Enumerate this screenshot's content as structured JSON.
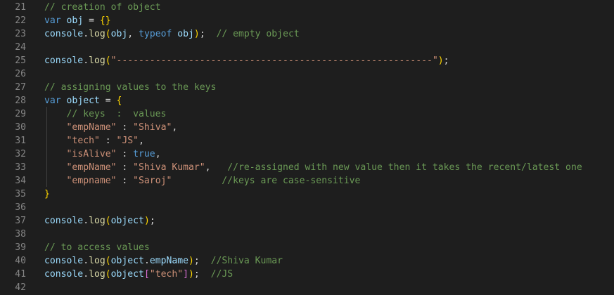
{
  "editor": {
    "theme": {
      "background": "#1e1e1e",
      "line_number": "#858585",
      "comment": "#6a9955",
      "keyword": "#569cd6",
      "variable": "#9cdcfe",
      "function": "#dcdcaa",
      "plain": "#d4d4d4",
      "string": "#ce9178",
      "bracket": "#ffd700",
      "bracket2": "#da70d6"
    },
    "lines": [
      {
        "num": "21",
        "tokens": [
          {
            "t": "// creation of object",
            "c": "comment"
          }
        ]
      },
      {
        "num": "22",
        "tokens": [
          {
            "t": "var",
            "c": "keyword"
          },
          {
            "t": " ",
            "c": "plain"
          },
          {
            "t": "obj",
            "c": "var"
          },
          {
            "t": " = ",
            "c": "plain"
          },
          {
            "t": "{}",
            "c": "bracket"
          }
        ]
      },
      {
        "num": "23",
        "tokens": [
          {
            "t": "console",
            "c": "var"
          },
          {
            "t": ".",
            "c": "plain"
          },
          {
            "t": "log",
            "c": "func"
          },
          {
            "t": "(",
            "c": "bracket"
          },
          {
            "t": "obj",
            "c": "var"
          },
          {
            "t": ", ",
            "c": "plain"
          },
          {
            "t": "typeof",
            "c": "keyword"
          },
          {
            "t": " ",
            "c": "plain"
          },
          {
            "t": "obj",
            "c": "var"
          },
          {
            "t": ")",
            "c": "bracket"
          },
          {
            "t": ";  ",
            "c": "plain"
          },
          {
            "t": "// empty object",
            "c": "comment"
          }
        ]
      },
      {
        "num": "24",
        "tokens": []
      },
      {
        "num": "25",
        "tokens": [
          {
            "t": "console",
            "c": "var"
          },
          {
            "t": ".",
            "c": "plain"
          },
          {
            "t": "log",
            "c": "func"
          },
          {
            "t": "(",
            "c": "bracket"
          },
          {
            "t": "\"---------------------------------------------------------\"",
            "c": "string"
          },
          {
            "t": ")",
            "c": "bracket"
          },
          {
            "t": ";",
            "c": "plain"
          }
        ]
      },
      {
        "num": "26",
        "tokens": []
      },
      {
        "num": "27",
        "tokens": [
          {
            "t": "// assigning values to the keys",
            "c": "comment"
          }
        ]
      },
      {
        "num": "28",
        "tokens": [
          {
            "t": "var",
            "c": "keyword"
          },
          {
            "t": " ",
            "c": "plain"
          },
          {
            "t": "object",
            "c": "var"
          },
          {
            "t": " = ",
            "c": "plain"
          },
          {
            "t": "{",
            "c": "bracket"
          }
        ]
      },
      {
        "num": "29",
        "tokens": [
          {
            "t": "    ",
            "c": "plain"
          },
          {
            "t": "// keys  :  values",
            "c": "comment"
          }
        ]
      },
      {
        "num": "30",
        "tokens": [
          {
            "t": "    ",
            "c": "plain"
          },
          {
            "t": "\"empName\"",
            "c": "string"
          },
          {
            "t": " : ",
            "c": "plain"
          },
          {
            "t": "\"Shiva\"",
            "c": "string"
          },
          {
            "t": ",",
            "c": "plain"
          }
        ]
      },
      {
        "num": "31",
        "tokens": [
          {
            "t": "    ",
            "c": "plain"
          },
          {
            "t": "\"tech\"",
            "c": "string"
          },
          {
            "t": " : ",
            "c": "plain"
          },
          {
            "t": "\"JS\"",
            "c": "string"
          },
          {
            "t": ",",
            "c": "plain"
          }
        ]
      },
      {
        "num": "32",
        "tokens": [
          {
            "t": "    ",
            "c": "plain"
          },
          {
            "t": "\"isAlive\"",
            "c": "string"
          },
          {
            "t": " : ",
            "c": "plain"
          },
          {
            "t": "true",
            "c": "bool"
          },
          {
            "t": ",",
            "c": "plain"
          }
        ]
      },
      {
        "num": "33",
        "tokens": [
          {
            "t": "    ",
            "c": "plain"
          },
          {
            "t": "\"empName\"",
            "c": "string"
          },
          {
            "t": " : ",
            "c": "plain"
          },
          {
            "t": "\"Shiva Kumar\"",
            "c": "string"
          },
          {
            "t": ",   ",
            "c": "plain"
          },
          {
            "t": "//re-assigned with new value then it takes the recent/latest one",
            "c": "comment"
          }
        ]
      },
      {
        "num": "34",
        "tokens": [
          {
            "t": "    ",
            "c": "plain"
          },
          {
            "t": "\"empname\"",
            "c": "string"
          },
          {
            "t": " : ",
            "c": "plain"
          },
          {
            "t": "\"Saroj\"",
            "c": "string"
          },
          {
            "t": "         ",
            "c": "plain"
          },
          {
            "t": "//keys are case-sensitive",
            "c": "comment"
          }
        ]
      },
      {
        "num": "35",
        "tokens": [
          {
            "t": "}",
            "c": "bracket"
          }
        ]
      },
      {
        "num": "36",
        "tokens": []
      },
      {
        "num": "37",
        "tokens": [
          {
            "t": "console",
            "c": "var"
          },
          {
            "t": ".",
            "c": "plain"
          },
          {
            "t": "log",
            "c": "func"
          },
          {
            "t": "(",
            "c": "bracket"
          },
          {
            "t": "object",
            "c": "var"
          },
          {
            "t": ")",
            "c": "bracket"
          },
          {
            "t": ";",
            "c": "plain"
          }
        ]
      },
      {
        "num": "38",
        "tokens": []
      },
      {
        "num": "39",
        "tokens": [
          {
            "t": "// to access values",
            "c": "comment"
          }
        ]
      },
      {
        "num": "40",
        "tokens": [
          {
            "t": "console",
            "c": "var"
          },
          {
            "t": ".",
            "c": "plain"
          },
          {
            "t": "log",
            "c": "func"
          },
          {
            "t": "(",
            "c": "bracket"
          },
          {
            "t": "object",
            "c": "var"
          },
          {
            "t": ".",
            "c": "plain"
          },
          {
            "t": "empName",
            "c": "var"
          },
          {
            "t": ")",
            "c": "bracket"
          },
          {
            "t": ";  ",
            "c": "plain"
          },
          {
            "t": "//Shiva Kumar",
            "c": "comment"
          }
        ]
      },
      {
        "num": "41",
        "tokens": [
          {
            "t": "console",
            "c": "var"
          },
          {
            "t": ".",
            "c": "plain"
          },
          {
            "t": "log",
            "c": "func"
          },
          {
            "t": "(",
            "c": "bracket"
          },
          {
            "t": "object",
            "c": "var"
          },
          {
            "t": "[",
            "c": "bracket2"
          },
          {
            "t": "\"tech\"",
            "c": "string"
          },
          {
            "t": "]",
            "c": "bracket2"
          },
          {
            "t": ")",
            "c": "bracket"
          },
          {
            "t": ";  ",
            "c": "plain"
          },
          {
            "t": "//JS",
            "c": "comment"
          }
        ]
      },
      {
        "num": "42",
        "tokens": []
      }
    ]
  }
}
